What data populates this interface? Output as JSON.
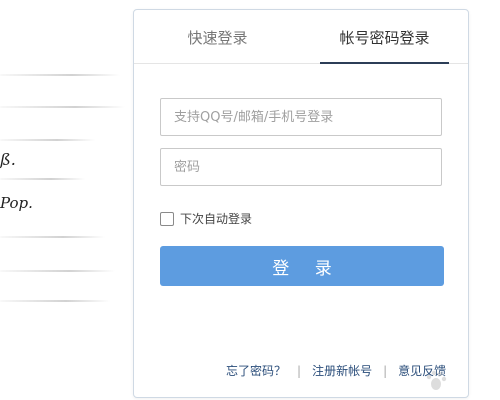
{
  "background": {
    "handwriting": [
      "ß.",
      "Pop."
    ]
  },
  "login_panel": {
    "tabs": [
      {
        "label": "快速登录",
        "active": false
      },
      {
        "label": "帐号密码登录",
        "active": true
      }
    ],
    "account_placeholder": "支持QQ号/邮箱/手机号登录",
    "password_placeholder": "密码",
    "remember_label": "下次自动登录",
    "remember_checked": false,
    "login_button": "登 录",
    "links": {
      "forgot": "忘了密码？",
      "register": "注册新帐号",
      "feedback": "意见反馈"
    }
  },
  "colors": {
    "button": "#5d9ce0",
    "link": "#2a4d7a",
    "panel_border": "#cfd9e4"
  }
}
